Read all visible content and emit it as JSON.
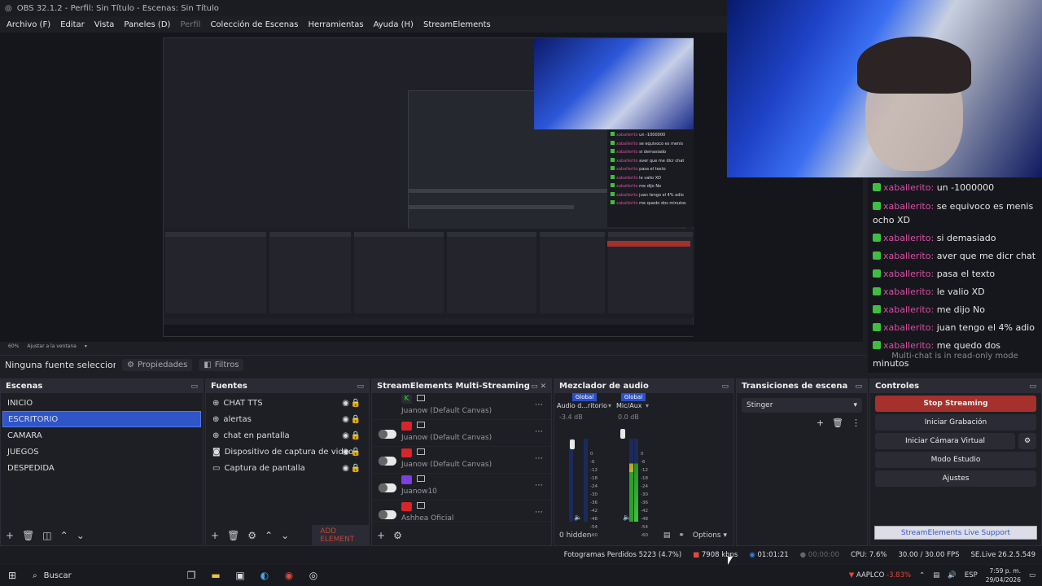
{
  "window": {
    "title": "OBS 32.1.2 - Perfil: Sin Título - Escenas: Sin Título"
  },
  "menu": [
    "Archivo (F)",
    "Editar",
    "Vista",
    "Paneles (D)",
    "Perfil",
    "Colección de Escenas",
    "Herramientas",
    "Ayuda (H)",
    "StreamElements"
  ],
  "chat": {
    "messages": [
      {
        "user": "xaballerito:",
        "text": "un -1000000"
      },
      {
        "user": "xaballerito:",
        "text": "se equivoco es menis ocho XD"
      },
      {
        "user": "xaballerito:",
        "text": "si demasiado"
      },
      {
        "user": "xaballerito:",
        "text": "aver que me dicr chat"
      },
      {
        "user": "xaballerito:",
        "text": "pasa el texto"
      },
      {
        "user": "xaballerito:",
        "text": "le valio XD"
      },
      {
        "user": "xaballerito:",
        "text": "me dijo No"
      },
      {
        "user": "xaballerito:",
        "text": "juan tengo el 4% adio"
      },
      {
        "user": "xaballerito:",
        "text": "me quedo dos minutos"
      }
    ],
    "readonly": "Multi-chat is in read-only mode"
  },
  "zoom": {
    "level": "60%",
    "fit": "Ajustar a la ventana"
  },
  "source_bar": {
    "none": "Ninguna fuente seleccionada",
    "properties": "Propiedades",
    "filters": "Filtros"
  },
  "scenes": {
    "title": "Escenas",
    "items": [
      "INICIO",
      "ESCRITORIO",
      "CAMARA",
      "JUEGOS",
      "DESPEDIDA"
    ],
    "selected": 1
  },
  "sources": {
    "title": "Fuentes",
    "items": [
      "CHAT TTS",
      "alertas",
      "chat en pantalla",
      "Dispositivo de captura de video",
      "Captura de pantalla"
    ],
    "add_label": "ADD ELEMENT"
  },
  "multistream": {
    "title": "StreamElements Multi-Streaming",
    "rows": [
      {
        "name": "Juanow (Default Canvas)",
        "platform": "kick"
      },
      {
        "name": "Juanow (Default Canvas)",
        "platform": "youtube"
      },
      {
        "name": "Juanow (Default Canvas)",
        "platform": "youtube"
      },
      {
        "name": "Juanow10",
        "platform": "twitch"
      },
      {
        "name": "Ashhea Oficial",
        "platform": "youtube"
      }
    ]
  },
  "mixer": {
    "title": "Mezclador de audio",
    "global": "Global",
    "ch1": {
      "name": "Audio d...ritorio",
      "db": "-3.4 dB"
    },
    "ch2": {
      "name": "Mic/Aux",
      "db": "0.0 dB"
    },
    "scale": [
      "0",
      "-6",
      "-12",
      "-18",
      "-24",
      "-30",
      "-36",
      "-42",
      "-48",
      "-54",
      "-60"
    ],
    "hidden": "0 hidden",
    "options": "Options"
  },
  "transitions": {
    "title": "Transiciones de escena",
    "selected": "Stinger"
  },
  "controls": {
    "title": "Controles",
    "stop": "Stop Streaming",
    "record": "Iniciar Grabación",
    "virtualcam": "Iniciar Cámara Virtual",
    "studio": "Modo Estudio",
    "settings": "Ajustes",
    "support": "StreamElements Live Support"
  },
  "status": {
    "dropped": "Fotogramas Perdidos 5223 (4.7%)",
    "bitrate": "7908 kbps",
    "live_time": "01:01:21",
    "rec_time": "00:00:00",
    "cpu": "CPU: 7.6%",
    "fps": "30.00 / 30.00 FPS",
    "version": "SE.Live 26.2.5.549"
  },
  "taskbar": {
    "search": "Buscar",
    "stock": "AAPLCO",
    "stock_change": "-3.83%",
    "lang": "ESP",
    "time": "7:59 p. m.",
    "date": "29/04/2026"
  }
}
